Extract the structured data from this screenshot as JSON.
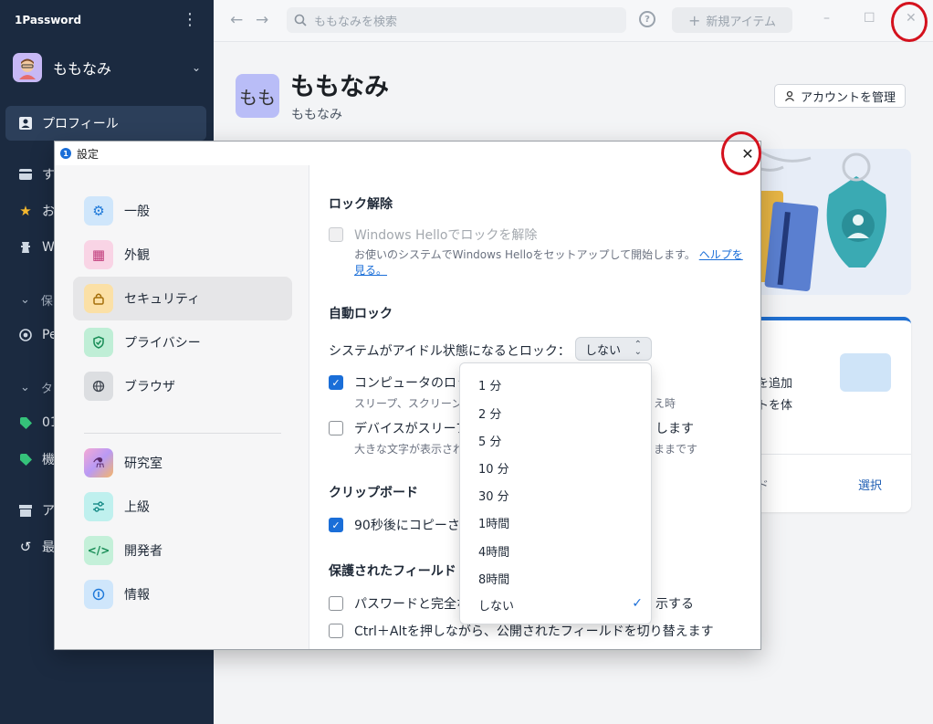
{
  "app": {
    "name": "1Password",
    "account_name": "ももなみ"
  },
  "sidebar": {
    "items": [
      {
        "label": "プロフィール",
        "icon": "profile-icon"
      },
      {
        "label": "す",
        "icon": "all-items-icon"
      },
      {
        "label": "お",
        "icon": "star-icon"
      },
      {
        "label": "W",
        "icon": "watchtower-icon"
      },
      {
        "label": "Pe",
        "icon": "vault-icon"
      },
      {
        "label": "01",
        "icon": "tag-icon"
      },
      {
        "label": "機",
        "icon": "tag-icon"
      },
      {
        "label": "ア",
        "icon": "archive-icon"
      },
      {
        "label": "最",
        "icon": "recent-icon"
      }
    ],
    "sections": [
      {
        "label": "保"
      },
      {
        "label": "タ"
      }
    ]
  },
  "toolbar": {
    "search_placeholder": "ももなみを検索",
    "new_item_label": "新規アイテム"
  },
  "profile": {
    "avatar_text": "もも",
    "title": "ももなみ",
    "subtitle": "ももなみ",
    "manage_label": "アカウントを管理"
  },
  "card": {
    "line1": "ドを追加",
    "line2": "ウトを体",
    "footer_left": "ード",
    "footer_right": "選択"
  },
  "dialog": {
    "title": "設定",
    "categories": [
      {
        "label": "一般",
        "icon": "gear-icon",
        "color": "#3aa3f0"
      },
      {
        "label": "外観",
        "icon": "palette-icon",
        "color": "#f4a7c8"
      },
      {
        "label": "セキュリティ",
        "icon": "lock-icon",
        "color": "#f7c66a"
      },
      {
        "label": "プライバシー",
        "icon": "shield-icon",
        "color": "#4ed29a"
      },
      {
        "label": "ブラウザ",
        "icon": "globe-icon",
        "color": "#a9adb3"
      },
      {
        "label": "研究室",
        "icon": "flask-icon",
        "color": "#e98ad0"
      },
      {
        "label": "上級",
        "icon": "sliders-icon",
        "color": "#47d7d2"
      },
      {
        "label": "開発者",
        "icon": "code-icon",
        "color": "#53d19a"
      },
      {
        "label": "情報",
        "icon": "info-icon",
        "color": "#3aa3f0"
      }
    ],
    "unlock": {
      "heading": "ロック解除",
      "windows_hello_label": "Windows Helloでロックを解除",
      "windows_hello_desc": "お使いのシステムでWindows Helloをセットアップして開始します。",
      "help_link_1": "ヘルプを",
      "help_link_2": "見る。"
    },
    "autolock": {
      "heading": "自動ロック",
      "idle_label": "システムがアイドル状態になるとロック：",
      "idle_value": "しない",
      "option1_label": "コンピュータのロッ",
      "option1_desc": "スリープ、スクリーン",
      "option1_desc_tail": "え時",
      "option2_label": "デバイスがスリーフ",
      "option2_tail": "します",
      "option2_desc": "大きな文字が表示され",
      "option2_desc_tail": "ままです"
    },
    "clipboard": {
      "heading": "クリップボード",
      "clear_label": "90秒後にコピーさ"
    },
    "protected": {
      "heading": "保護されたフィールド",
      "opt1_label": "パスワードと完全な",
      "opt1_tail": "示する",
      "opt2_label": "Ctrl＋Altを押しながら、公開されたフィールドを切り替えます"
    }
  },
  "dropdown": {
    "options": [
      "1 分",
      "2 分",
      "5 分",
      "10 分",
      "30 分",
      "1時間",
      "4時間",
      "8時間",
      "しない"
    ],
    "selected": "しない"
  }
}
